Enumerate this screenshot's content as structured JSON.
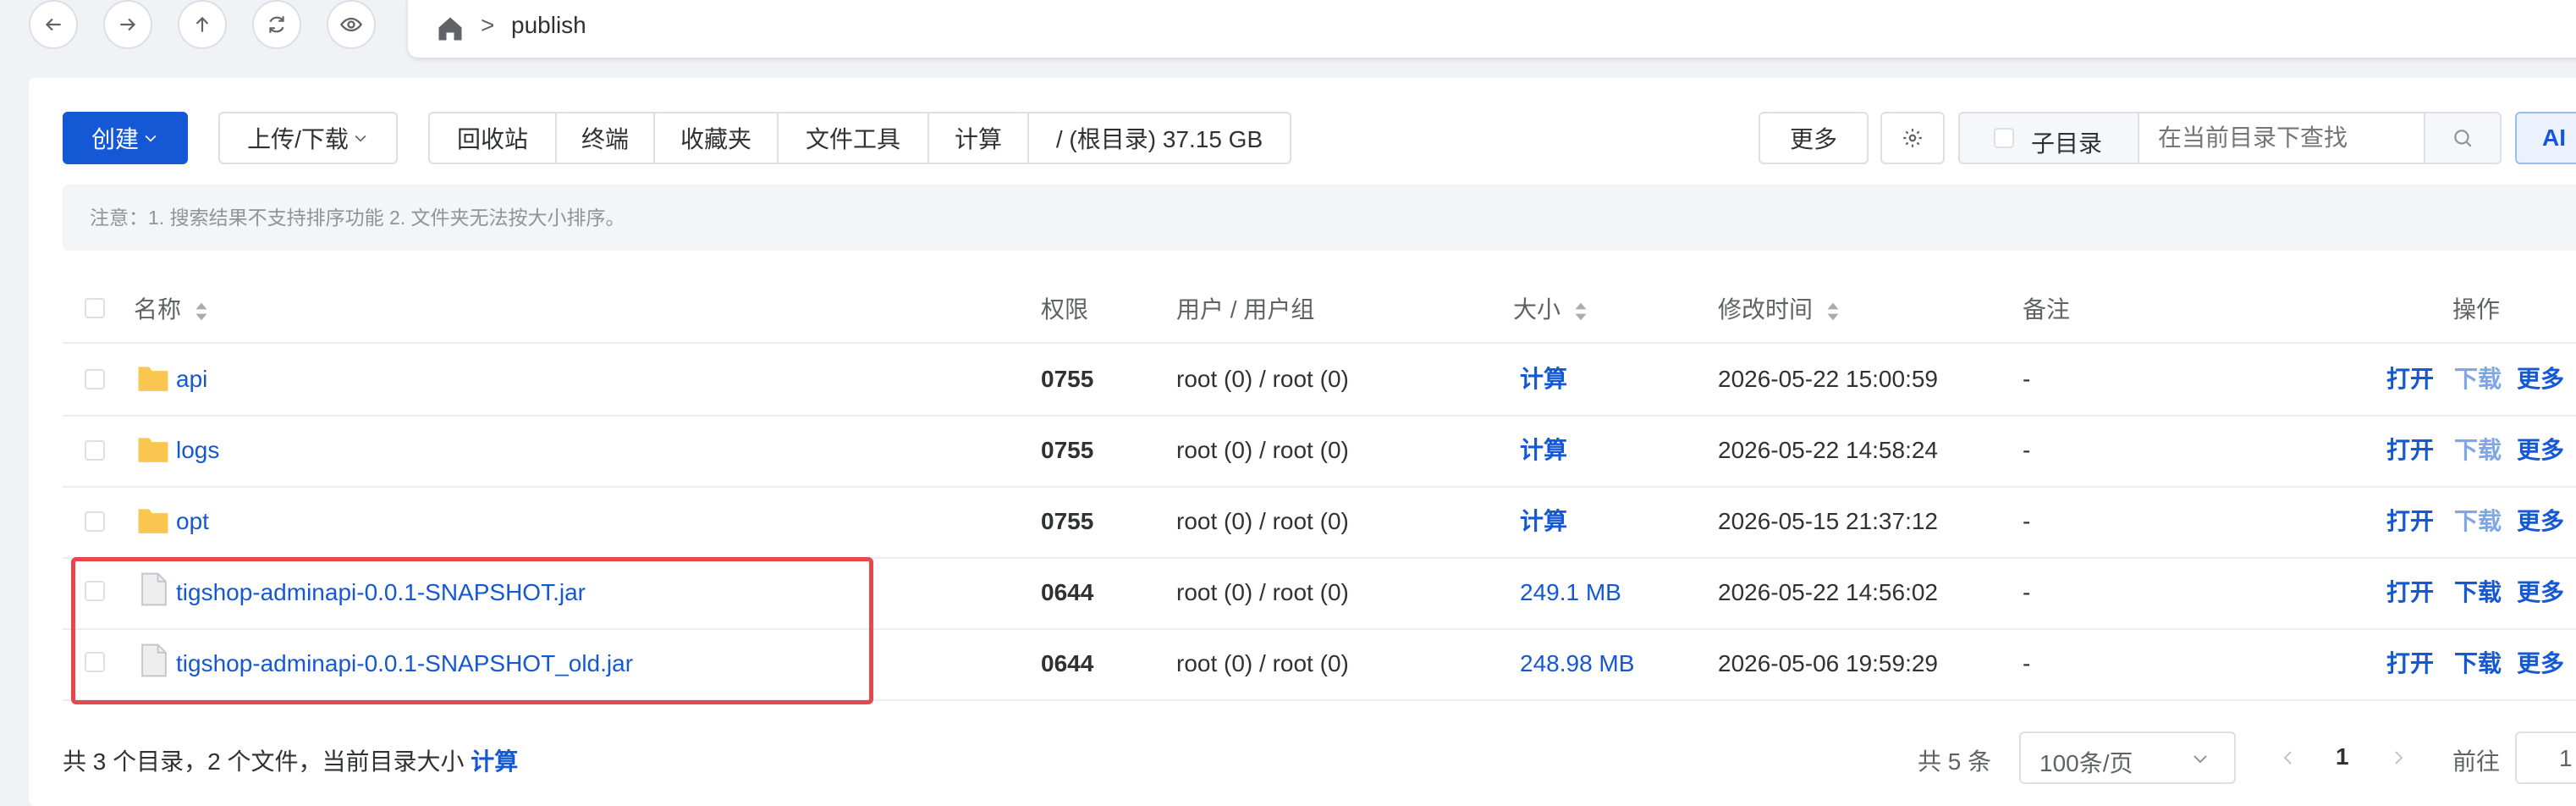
{
  "nav": {
    "back_icon": "arrow-left-icon",
    "forward_icon": "arrow-right-icon",
    "up_icon": "arrow-up-icon",
    "refresh_icon": "refresh-icon",
    "view_icon": "eye-icon",
    "home_icon": "home-icon",
    "separator": ">",
    "current_path": "publish"
  },
  "toolbar": {
    "create_label": "创建",
    "upload_label": "上传/下载",
    "group": [
      "回收站",
      "终端",
      "收藏夹",
      "文件工具",
      "计算"
    ],
    "disk_info": "/ (根目录) 37.15 GB",
    "more_label": "更多",
    "settings_icon": "gear-icon",
    "subdir_label": "子目录",
    "search_placeholder": "在当前目录下查找",
    "search_icon": "search-icon",
    "ai_label": "AI"
  },
  "notice": "注意：1. 搜索结果不支持排序功能 2. 文件夹无法按大小排序。",
  "table": {
    "headers": {
      "name": "名称",
      "perm": "权限",
      "owner": "用户 / 用户组",
      "size": "大小",
      "mtime": "修改时间",
      "note": "备注",
      "ops": "操作"
    },
    "rows": [
      {
        "type": "folder",
        "name": "api",
        "perm": "0755",
        "owner": "root (0) / root (0)",
        "size": "计算",
        "mtime": "2026-05-22 15:00:59",
        "note": "-"
      },
      {
        "type": "folder",
        "name": "logs",
        "perm": "0755",
        "owner": "root (0) / root (0)",
        "size": "计算",
        "mtime": "2026-05-22 14:58:24",
        "note": "-"
      },
      {
        "type": "folder",
        "name": "opt",
        "perm": "0755",
        "owner": "root (0) / root (0)",
        "size": "计算",
        "mtime": "2026-05-15 21:37:12",
        "note": "-"
      },
      {
        "type": "file",
        "name": "tigshop-adminapi-0.0.1-SNAPSHOT.jar",
        "perm": "0644",
        "owner": "root (0) / root (0)",
        "size": "249.1 MB",
        "mtime": "2026-05-22 14:56:02",
        "note": "-"
      },
      {
        "type": "file",
        "name": "tigshop-adminapi-0.0.1-SNAPSHOT_old.jar",
        "perm": "0644",
        "owner": "root (0) / root (0)",
        "size": "248.98 MB",
        "mtime": "2026-05-06 19:59:29",
        "note": "-"
      }
    ],
    "actions": {
      "open": "打开",
      "download": "下载",
      "more": "更多"
    }
  },
  "footer": {
    "summary": "共 3 个目录，2 个文件，当前目录大小",
    "calc": "计算",
    "total": "共 5 条",
    "page_size": "100条/页",
    "current_page": "1",
    "goto_label": "前往",
    "goto_value": "1"
  },
  "colors": {
    "primary": "#1558d6",
    "highlight_box": "#e5484d",
    "folder": "#f9c74f"
  }
}
